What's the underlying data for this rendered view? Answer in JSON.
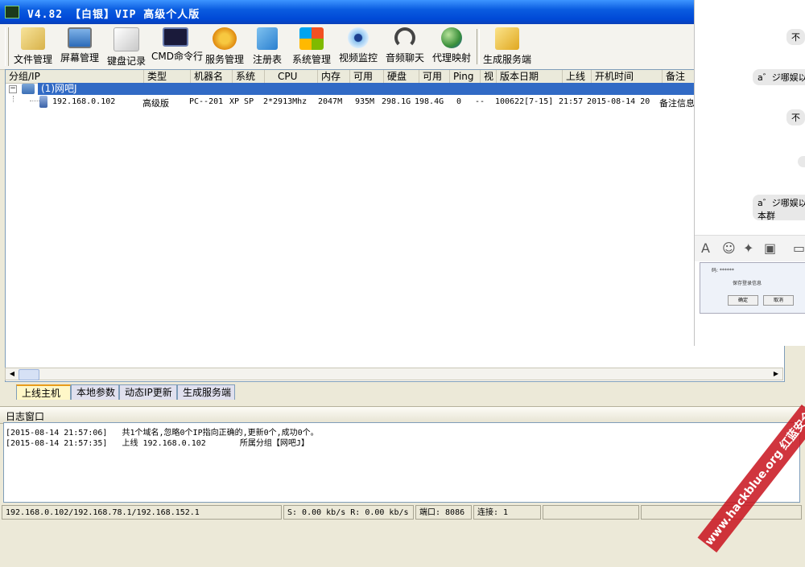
{
  "window": {
    "title": "V4.82 【白银】VIP 高级个人版"
  },
  "toolbar": {
    "buttons": [
      {
        "label": "文件管理"
      },
      {
        "label": "屏幕管理"
      },
      {
        "label": "键盘记录"
      },
      {
        "label": "CMD命令行"
      },
      {
        "label": "服务管理"
      },
      {
        "label": "注册表"
      },
      {
        "label": "系统管理"
      },
      {
        "label": "视频监控"
      },
      {
        "label": "音频聊天"
      },
      {
        "label": "代理映射"
      },
      {
        "label": "生成服务端"
      }
    ]
  },
  "list": {
    "columns": [
      "分组/IP",
      "类型",
      "机器名",
      "系统",
      "CPU",
      "内存",
      "可用",
      "硬盘",
      "可用",
      "Ping",
      "视",
      "版本日期",
      "上线",
      "开机时间",
      "备注"
    ],
    "group": {
      "label": "(1)网吧J"
    },
    "host": {
      "ip": "192.168.0.102",
      "type": "高级版",
      "machine": "PC--201",
      "os": "XP SP",
      "cpu": "2*2913Mhz",
      "memory": "2047M",
      "mem_free": "935M",
      "disk": "298.1G",
      "disk_free": "198.4G",
      "ping": "0",
      "video": "--",
      "version": "100622[7-15]",
      "online": "21:57",
      "boot_time": "2015-08-14 20",
      "note": "备注信息"
    }
  },
  "tabs": [
    "上线主机",
    "本地参数",
    "动态IP更新",
    "生成服务端"
  ],
  "log": {
    "title": "日志窗口",
    "lines": [
      "[2015-08-14 21:57:06]   共1个域名,忽略0个IP指向正确的,更新0个,成功0个。",
      "[2015-08-14 21:57:35]   上线 192.168.0.102       所属分组【网吧J】"
    ]
  },
  "status": {
    "ips": "192.168.0.102/192.168.78.1/192.168.152.1",
    "speed": "S: 0.00 kb/s R: 0.00 kb/s",
    "port": "端口: 8086",
    "connections": "连接: 1"
  },
  "chat": {
    "m1": "不",
    "m2": "a゛ジ哪娱以",
    "m3": "不",
    "m4": "a゛ジ哪娱以",
    "m5": "本群",
    "login_pwd": "码: ******",
    "remember": "保存登录信息",
    "ok": "确定",
    "cancel": "取消"
  },
  "watermark": "www.hackblue.org 红蓝安全网",
  "colors": {
    "title_bar": "#0a5ce0",
    "selection": "#316ac5",
    "watermark": "#c8141e"
  }
}
